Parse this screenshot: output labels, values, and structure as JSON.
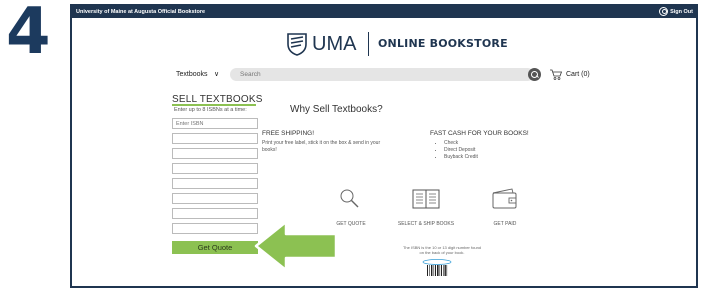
{
  "step": {
    "number": "4"
  },
  "topbar": {
    "university": "University of Maine at Augusta Official Bookstore",
    "sign_out": "Sign Out",
    "user_icon": "user-circle-icon"
  },
  "header": {
    "logo_text": "UMA",
    "store_name": "ONLINE BOOKSTORE"
  },
  "nav": {
    "textbooks_label": "Textbooks",
    "chevron": "∨",
    "search_placeholder": "Search",
    "cart_label": "Cart (0)"
  },
  "sell_form": {
    "title": "SELL TEXTBOOKS",
    "subtitle": "Enter up to 8 ISBNs at a time:",
    "isbn_placeholder": "Enter ISBN",
    "fields": [
      "Enter ISBN",
      "",
      "",
      "",
      "",
      "",
      "",
      ""
    ],
    "button_label": "Get Quote"
  },
  "content": {
    "heading": "Why Sell Textbooks?",
    "free_shipping_title": "FREE SHIPPING!",
    "free_shipping_text": "Print your free label, stick it on the box & send in your books!",
    "fast_cash_title": "FAST CASH FOR YOUR BOOKS!",
    "fast_cash_items": [
      "Check",
      "Direct Deposit",
      "Buyback Credit"
    ],
    "steps": [
      {
        "label": "GET QUOTE",
        "icon": "magnifier-icon"
      },
      {
        "label": "SELECT & SHIP BOOKS",
        "icon": "book-icon"
      },
      {
        "label": "GET PAID",
        "icon": "wallet-icon"
      }
    ],
    "isbn_note": "The ISBN is the 10 or 13 digit number found on the back of your book."
  },
  "colors": {
    "navy": "#1f3550",
    "green": "#8cc152",
    "arrow_green": "#8cc152"
  }
}
